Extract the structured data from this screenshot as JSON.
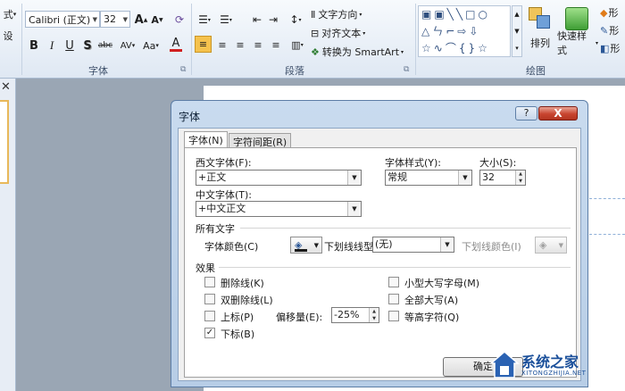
{
  "ribbon": {
    "cut_left_1": "式",
    "cut_left_2": "设",
    "font_name": "Calibri (正文)",
    "font_size": "32",
    "grow_font": "A",
    "shrink_font": "A",
    "bold": "B",
    "italic": "I",
    "underline": "U",
    "shadow": "S",
    "strike": "abc",
    "char_spacing": "AV",
    "change_case": "Aa",
    "font_color": "A",
    "font_group_label": "字体",
    "text_direction": "文字方向",
    "align_text": "对齐文本",
    "convert_smartart": "转换为 SmartArt",
    "paragraph_group_label": "段落",
    "arrange_label": "排列",
    "quick_styles_label": "快速样式",
    "shape_fill": "形",
    "shape_outline": "形",
    "shape_effects": "形",
    "drawing_group_label": "绘图"
  },
  "dialog": {
    "title": "字体",
    "help": "?",
    "close": "X",
    "tabs": [
      "字体(N)",
      "字符间距(R)"
    ],
    "latin_font_label": "西文字体(F):",
    "latin_font_value": "+正文",
    "style_label": "字体样式(Y):",
    "style_value": "常规",
    "size_label": "大小(S):",
    "size_value": "32",
    "asian_font_label": "中文字体(T):",
    "asian_font_value": "+中文正文",
    "all_text_label": "所有文字",
    "font_color_label": "字体颜色(C)",
    "underline_style_label": "下划线线型(U)",
    "underline_style_value": "(无)",
    "underline_color_label": "下划线颜色(I)",
    "effects_label": "效果",
    "effects": {
      "strikethrough": "删除线(K)",
      "double_strikethrough": "双删除线(L)",
      "superscript": "上标(P)",
      "subscript": "下标(B)",
      "offset_label": "偏移量(E):",
      "offset_value": "-25%",
      "small_caps": "小型大写字母(M)",
      "all_caps": "全部大写(A)",
      "equalize_height": "等高字符(Q)"
    },
    "ok_label": "确定"
  },
  "watermark": {
    "text": "系统之家",
    "sub": "XITONGZHIJIA.NET"
  },
  "colors": {
    "accent_blue": "#2b5797",
    "close_red": "#c8442f",
    "highlight_orange": "#f5c24d"
  },
  "checkbox_state": {
    "strikethrough": false,
    "double_strikethrough": false,
    "superscript": false,
    "subscript": true,
    "small_caps": false,
    "all_caps": false,
    "equalize_height": false
  }
}
